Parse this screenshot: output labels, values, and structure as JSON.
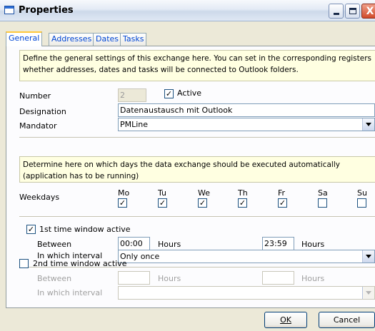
{
  "window": {
    "title": "Properties",
    "close_glyph": "X"
  },
  "tabs": [
    {
      "label": "General",
      "active": true
    },
    {
      "label": "Addresses",
      "active": false
    },
    {
      "label": "Dates",
      "active": false
    },
    {
      "label": "Tasks",
      "active": false
    }
  ],
  "info": {
    "general": "Define the general settings of this exchange here. You can set in the corresponding registers whether addresses, dates and tasks will be connected to Outlook folders.",
    "days": "Determine here on which days the data exchange should be executed automatically (application has to be running)"
  },
  "form": {
    "number_label": "Number",
    "number_value": "2",
    "active_label": "Active",
    "active_checked": true,
    "designation_label": "Designation",
    "designation_value": "Datenaustausch mit Outlook",
    "mandator_label": "Mandator",
    "mandator_value": "PMLine"
  },
  "weekdays": {
    "label": "Weekdays",
    "days": [
      {
        "label": "Mo",
        "checked": true
      },
      {
        "label": "Tu",
        "checked": true
      },
      {
        "label": "We",
        "checked": true
      },
      {
        "label": "Th",
        "checked": true
      },
      {
        "label": "Fr",
        "checked": true
      },
      {
        "label": "Sa",
        "checked": false
      },
      {
        "label": "Su",
        "checked": false
      }
    ]
  },
  "window1": {
    "label": "1st time window active",
    "checked": true,
    "between_label": "Between",
    "from": "00:00",
    "to": "23:59",
    "hours_label": "Hours",
    "interval_label": "In which interval",
    "interval_value": "Only once"
  },
  "window2": {
    "label": "2nd time window active",
    "checked": false,
    "between_label": "Between",
    "from": "",
    "to": "",
    "hours_label": "Hours",
    "interval_label": "In which interval",
    "interval_value": ""
  },
  "buttons": {
    "ok": "OK",
    "cancel": "Cancel"
  },
  "colors": {
    "info_bg": "#ffffe1",
    "tab_text": "#0046d5",
    "dialog_bg": "#ece9d8"
  }
}
